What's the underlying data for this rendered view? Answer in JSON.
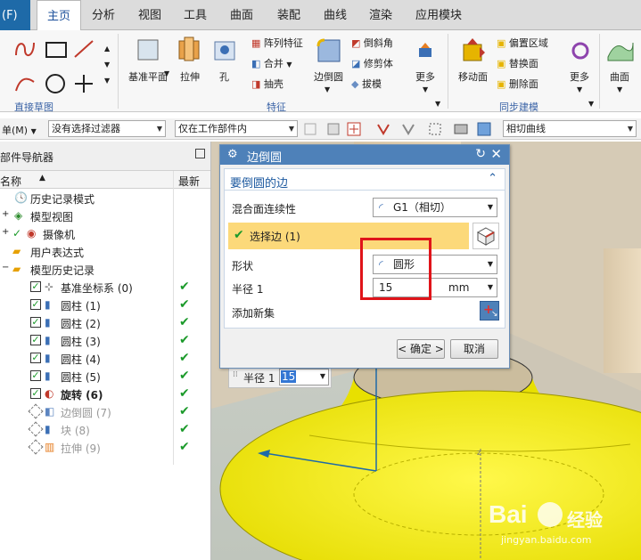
{
  "menubar": {
    "file": "(F)",
    "items": [
      "主页",
      "分析",
      "视图",
      "工具",
      "曲面",
      "装配",
      "曲线",
      "渲染",
      "应用模块"
    ],
    "active": "主页"
  },
  "ribbon": {
    "groups": {
      "sketch": "直接草图",
      "feature": "特征",
      "sync": "同步建模"
    },
    "buttons": {
      "datum_plane": "基准平面",
      "extrude": "拉伸",
      "hole": "孔",
      "pattern": "阵列特征",
      "unite": "合并",
      "shell": "抽壳",
      "edge_blend": "边倒圆",
      "chamfer": "倒斜角",
      "trim_body": "修剪体",
      "draft": "拔模",
      "more_feature": "更多",
      "move_face": "移动面",
      "offset_region": "偏置区域",
      "replace_face": "替换面",
      "delete_face": "删除面",
      "more_sync": "更多",
      "surface": "曲面"
    }
  },
  "toolbar2": {
    "menu_label": "单(M)",
    "filter": "没有选择过滤器",
    "scope": "仅在工作部件内",
    "curve_rule": "相切曲线"
  },
  "navigator": {
    "title": "部件导航器",
    "col_name": "名称",
    "col_latest": "最新",
    "rows": [
      {
        "label": "历史记录模式",
        "state": "normal",
        "check": ""
      },
      {
        "label": "模型视图",
        "state": "normal",
        "check": ""
      },
      {
        "label": "摄像机",
        "state": "normal",
        "check": ""
      },
      {
        "label": "用户表达式",
        "state": "normal",
        "check": ""
      },
      {
        "label": "模型历史记录",
        "state": "normal",
        "check": ""
      },
      {
        "label": "基准坐标系 (0)",
        "state": "normal",
        "check": "✔"
      },
      {
        "label": "圆柱 (1)",
        "state": "normal",
        "check": "✔"
      },
      {
        "label": "圆柱 (2)",
        "state": "normal",
        "check": "✔"
      },
      {
        "label": "圆柱 (3)",
        "state": "normal",
        "check": "✔"
      },
      {
        "label": "圆柱 (4)",
        "state": "normal",
        "check": "✔"
      },
      {
        "label": "圆柱 (5)",
        "state": "normal",
        "check": "✔"
      },
      {
        "label": "旋转 (6)",
        "state": "bold",
        "check": "✔"
      },
      {
        "label": "边倒圆 (7)",
        "state": "grey",
        "check": "✔"
      },
      {
        "label": "块 (8)",
        "state": "grey",
        "check": "✔"
      },
      {
        "label": "拉伸 (9)",
        "state": "grey",
        "check": "✔"
      }
    ]
  },
  "dialog": {
    "title": "边倒圆",
    "section": "要倒圆的边",
    "continuity_label": "混合面连续性",
    "continuity_value": "G1（相切）",
    "select_edge": "选择边 (1)",
    "shape_label": "形状",
    "shape_value": "圆形",
    "radius_label": "半径 1",
    "radius_value": "15",
    "radius_unit": "mm",
    "add_set": "添加新集",
    "ok": "< 确定 >",
    "cancel": "取消"
  },
  "floating_field": {
    "label": "半径 1",
    "value": "15"
  },
  "watermark": {
    "brand_a": "Bai",
    "brand_b": "经验",
    "url": "jingyan.baidu.com"
  },
  "colors": {
    "accent": "#1e6aa8",
    "dialog_title": "#4e81b9",
    "highlight_row": "#fcd97a",
    "model_yellow": "#f4f000",
    "red_box": "#e0141a",
    "check_green": "#1b9a2a"
  }
}
